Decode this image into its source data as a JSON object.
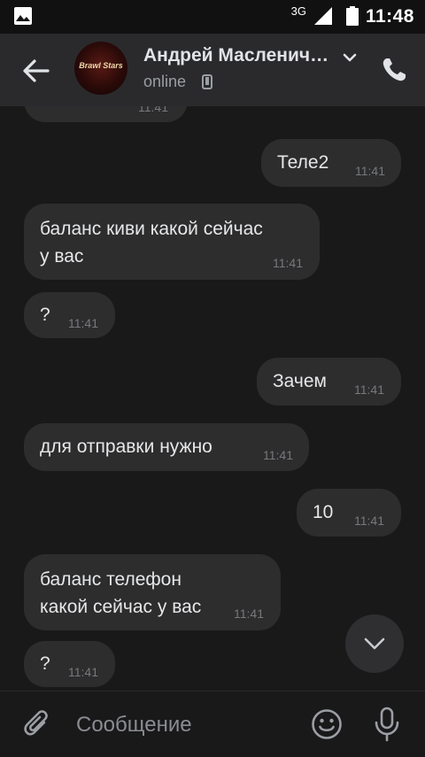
{
  "status_bar": {
    "network": "3G",
    "time": "11:48"
  },
  "header": {
    "contact_name": "Андрей Маслениченко",
    "status": "online",
    "avatar_text": "Brawl Stars"
  },
  "messages": [
    {
      "direction": "incoming",
      "text": "",
      "time": "11:41"
    },
    {
      "direction": "outgoing",
      "text": "Теле2",
      "time": "11:41"
    },
    {
      "direction": "incoming",
      "text": "баланс киви какой сейчас у вас",
      "time": "11:41"
    },
    {
      "direction": "incoming",
      "text": "?",
      "time": "11:41"
    },
    {
      "direction": "outgoing",
      "text": "Зачем",
      "time": "11:41"
    },
    {
      "direction": "incoming",
      "text": "для отправки нужно",
      "time": "11:41"
    },
    {
      "direction": "outgoing",
      "text": "10",
      "time": "11:41"
    },
    {
      "direction": "incoming",
      "text": "баланс телефон какой сейчас у вас",
      "time": "11:41"
    },
    {
      "direction": "incoming",
      "text": "?",
      "time": "11:41"
    }
  ],
  "composer": {
    "placeholder": "Сообщение"
  },
  "icons": {
    "back": "arrow-left-icon",
    "dropdown": "chevron-down-icon",
    "call": "phone-icon",
    "attach": "paperclip-icon",
    "emoji": "smile-icon",
    "voice": "microphone-icon",
    "scroll": "chevron-down-icon",
    "device": "mobile-device-icon"
  }
}
